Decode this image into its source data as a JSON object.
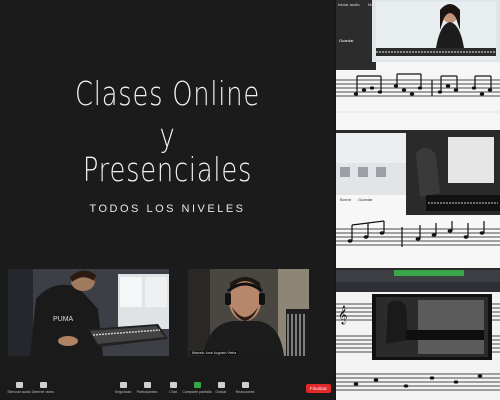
{
  "title": {
    "line1": "Clases Online",
    "line2": "y",
    "line3": "Presenciales"
  },
  "subtitle": "TODOS LOS NIVELES",
  "participants": [
    {
      "name": ""
    },
    {
      "name": "Marcelo José Augusto Vieira"
    }
  ],
  "zoom_toolbar": {
    "items": [
      {
        "label": "Silenciar audio",
        "icon": "microphone-icon"
      },
      {
        "label": "Detener video",
        "icon": "video-camera-icon"
      },
      {
        "label": "Seguridad",
        "icon": "shield-icon"
      },
      {
        "label": "Participantes",
        "icon": "participants-icon"
      },
      {
        "label": "Chat",
        "icon": "chat-icon"
      },
      {
        "label": "Compartir pantalla",
        "icon": "share-screen-icon"
      },
      {
        "label": "Grabar",
        "icon": "record-icon"
      },
      {
        "label": "Reacciones",
        "icon": "reactions-icon"
      }
    ],
    "end_label": "Finalizar",
    "accent": "#3aa64a",
    "end_color": "#e02828"
  },
  "right_top_toolbar": {
    "mute_label": "Iniciar audio",
    "more_label": "Más"
  },
  "panel_toolbar": {
    "save_label": "Guardar",
    "delete_label": "Borrar"
  }
}
